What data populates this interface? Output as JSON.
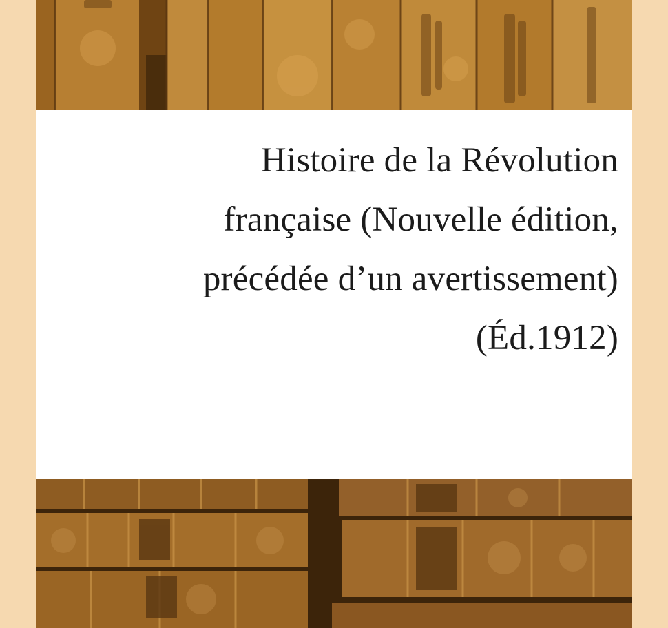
{
  "book": {
    "title_lines": [
      "Histoire de la Révolution",
      "française (Nouvelle édition,",
      "précédée d’un avertissement)",
      "(Éd.1912)"
    ]
  },
  "artwork": {
    "description": "sepia photograph of antique leather book spines",
    "colors": {
      "page_background": "#f6d9b0",
      "sepia_light": "#c58e3a",
      "sepia_dark": "#4a2d0c",
      "panel": "#ffffff",
      "text": "#1b1b1b"
    }
  }
}
